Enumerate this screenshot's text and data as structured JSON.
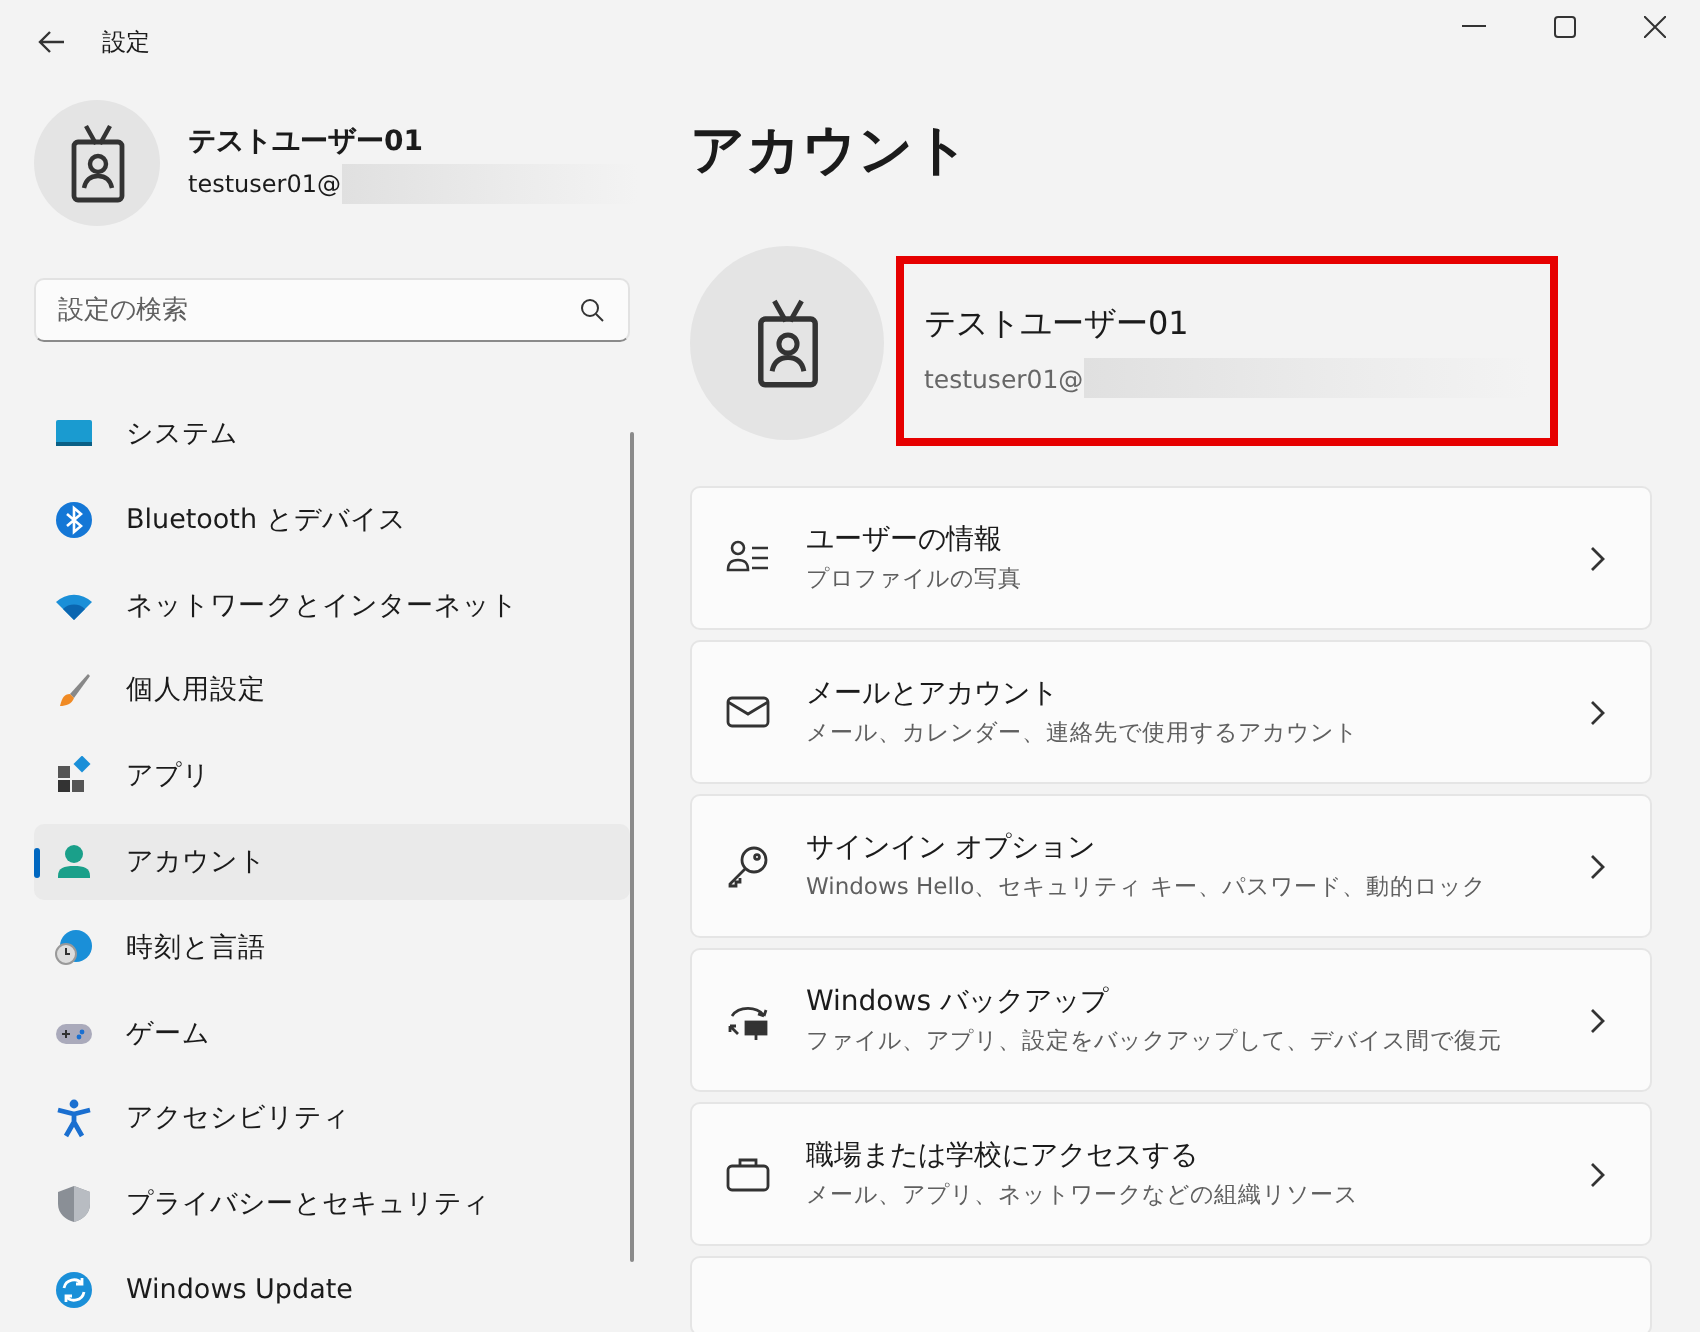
{
  "window": {
    "title": "設定"
  },
  "profile": {
    "name": "テストユーザー01",
    "email": "testuser01@"
  },
  "search": {
    "placeholder": "設定の検索"
  },
  "sidebar": {
    "items": [
      {
        "label": "システム",
        "selected": false
      },
      {
        "label": "Bluetooth とデバイス",
        "selected": false
      },
      {
        "label": "ネットワークとインターネット",
        "selected": false
      },
      {
        "label": "個人用設定",
        "selected": false
      },
      {
        "label": "アプリ",
        "selected": false
      },
      {
        "label": "アカウント",
        "selected": true
      },
      {
        "label": "時刻と言語",
        "selected": false
      },
      {
        "label": "ゲーム",
        "selected": false
      },
      {
        "label": "アクセシビリティ",
        "selected": false
      },
      {
        "label": "プライバシーとセキュリティ",
        "selected": false
      },
      {
        "label": "Windows Update",
        "selected": false
      }
    ]
  },
  "page": {
    "title": "アカウント",
    "account": {
      "name": "テストユーザー01",
      "email": "testuser01@"
    },
    "cards": [
      {
        "title": "ユーザーの情報",
        "subtitle": "プロファイルの写真"
      },
      {
        "title": "メールとアカウント",
        "subtitle": "メール、カレンダー、連絡先で使用するアカウント"
      },
      {
        "title": "サインイン オプション",
        "subtitle": "Windows Hello、セキュリティ キー、パスワード、動的ロック"
      },
      {
        "title": "Windows バックアップ",
        "subtitle": "ファイル、アプリ、設定をバックアップして、デバイス間で復元"
      },
      {
        "title": "職場または学校にアクセスする",
        "subtitle": "メール、アプリ、ネットワークなどの組織リソース"
      }
    ]
  }
}
